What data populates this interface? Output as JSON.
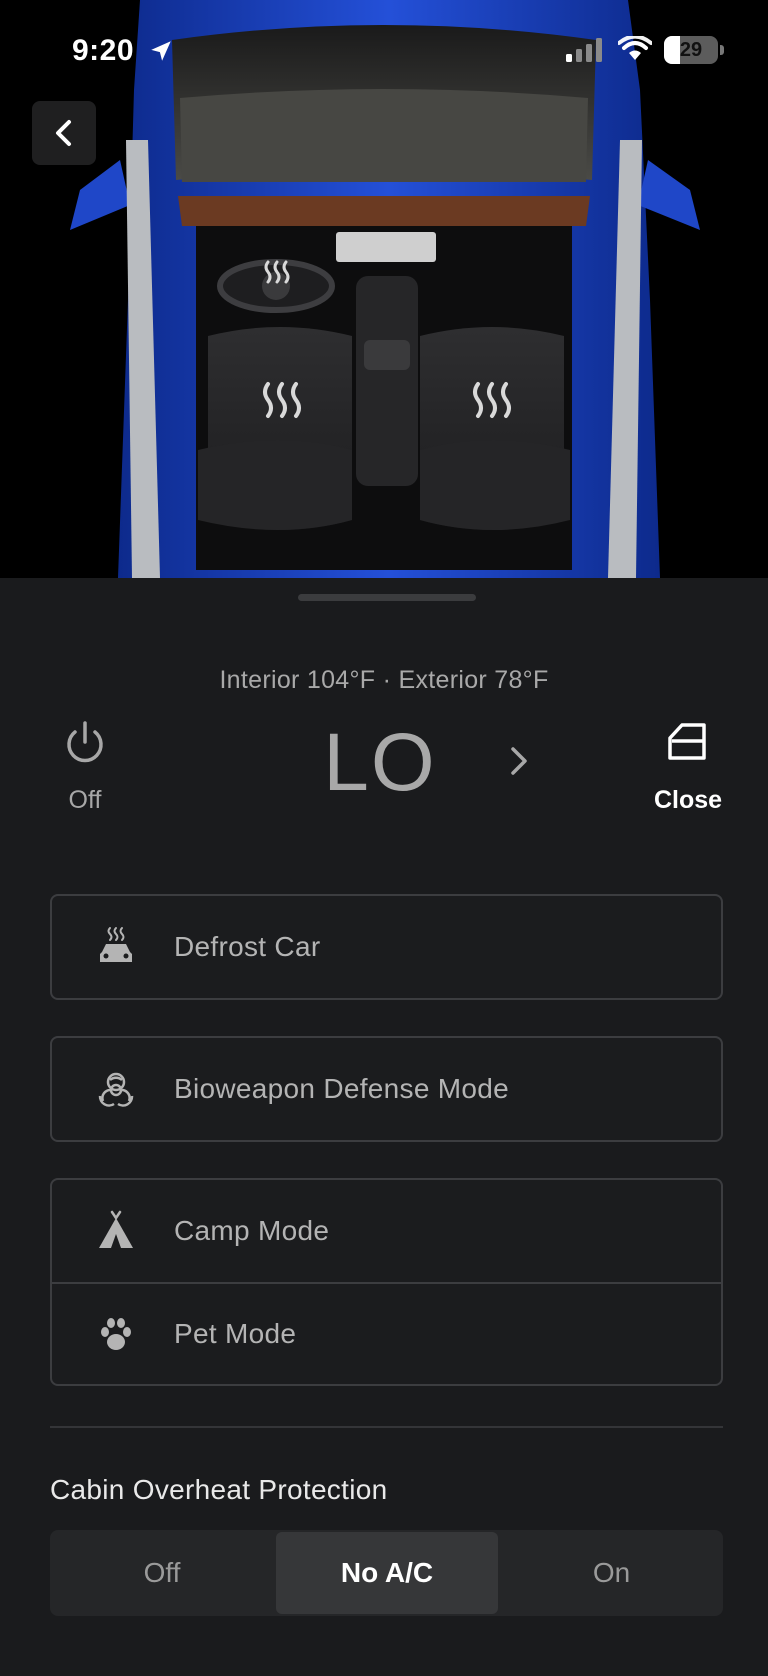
{
  "status_bar": {
    "time": "9:20",
    "battery_level": "29",
    "battery_fraction": 0.29
  },
  "icons": {
    "back": "chevron-left-icon",
    "power": "power-icon",
    "next": "chevron-right-icon",
    "door": "car-door-icon",
    "defrost": "defrost-car-icon",
    "bioweapon": "biohazard-icon",
    "camp": "tent-icon",
    "pet": "paw-icon"
  },
  "climate": {
    "temperatures_text": "Interior 104°F · Exterior 78°F",
    "power_label": "Off",
    "setting": "LO",
    "close_label": "Close"
  },
  "modes": {
    "defrost_label": "Defrost Car",
    "bioweapon_label": "Bioweapon Defense Mode",
    "camp_label": "Camp Mode",
    "pet_label": "Pet Mode"
  },
  "overheat": {
    "title": "Cabin Overheat Protection",
    "options": [
      "Off",
      "No A/C",
      "On"
    ],
    "selected": "No A/C"
  },
  "colors": {
    "background": "#1a1b1d",
    "car_body": "#1a3fb8",
    "accent_active_segment": "#363739"
  }
}
